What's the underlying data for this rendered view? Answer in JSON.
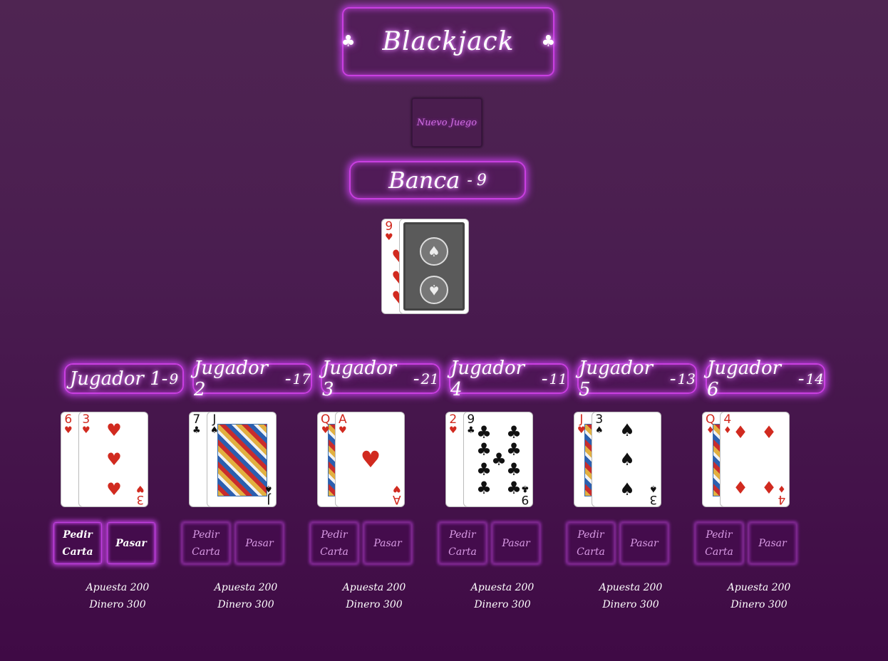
{
  "title": {
    "text": "Blackjack",
    "suit_icon": "club"
  },
  "new_game_label": "Nuevo Juego",
  "bank": {
    "label": "Banca",
    "separator": "-",
    "score": "9",
    "cards": [
      {
        "rank": "9",
        "suit": "♥",
        "color": "red"
      },
      {
        "face_down": true
      }
    ]
  },
  "players": [
    {
      "label": "Jugador 1",
      "score": "9",
      "hit_label": "Pedir Carta",
      "stand_label": "Pasar",
      "bet": "Apuesta 200",
      "money": "Dinero 300",
      "active": true,
      "cards": [
        {
          "rank": "6",
          "suit": "♥"
        },
        {
          "rank": "3",
          "suit": "♥"
        }
      ]
    },
    {
      "label": "Jugador 2",
      "score": "17",
      "hit_label": "Pedir Carta",
      "stand_label": "Pasar",
      "bet": "Apuesta 200",
      "money": "Dinero 300",
      "active": false,
      "cards": [
        {
          "rank": "7",
          "suit": "♣"
        },
        {
          "rank": "J",
          "suit": "♠"
        }
      ]
    },
    {
      "label": "Jugador 3",
      "score": "21",
      "hit_label": "Pedir Carta",
      "stand_label": "Pasar",
      "bet": "Apuesta 200",
      "money": "Dinero 300",
      "active": false,
      "cards": [
        {
          "rank": "Q",
          "suit": "♥"
        },
        {
          "rank": "A",
          "suit": "♥"
        }
      ]
    },
    {
      "label": "Jugador 4",
      "score": "11",
      "hit_label": "Pedir Carta",
      "stand_label": "Pasar",
      "bet": "Apuesta 200",
      "money": "Dinero 300",
      "active": false,
      "cards": [
        {
          "rank": "2",
          "suit": "♥"
        },
        {
          "rank": "9",
          "suit": "♣"
        }
      ]
    },
    {
      "label": "Jugador 5",
      "score": "13",
      "hit_label": "Pedir Carta",
      "stand_label": "Pasar",
      "bet": "Apuesta 200",
      "money": "Dinero 300",
      "active": false,
      "cards": [
        {
          "rank": "J",
          "suit": "♥"
        },
        {
          "rank": "3",
          "suit": "♠"
        }
      ]
    },
    {
      "label": "Jugador 6",
      "score": "14",
      "hit_label": "Pedir Carta",
      "stand_label": "Pasar",
      "bet": "Apuesta 200",
      "money": "Dinero 300",
      "active": false,
      "cards": [
        {
          "rank": "Q",
          "suit": "♦"
        },
        {
          "rank": "4",
          "suit": "♦"
        }
      ]
    }
  ],
  "colors": {
    "accent": "#c93fe0",
    "card_red": "#d12a1f",
    "card_black": "#111111"
  }
}
